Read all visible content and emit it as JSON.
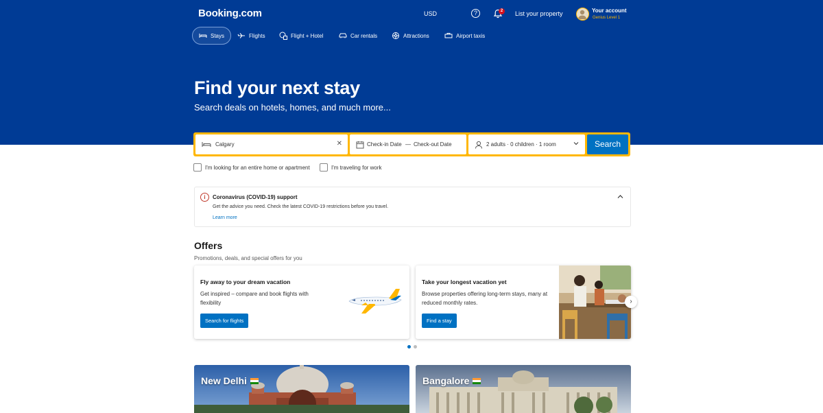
{
  "header": {
    "logo": "Booking.com",
    "currency": "USD",
    "help_glyph": "?",
    "notification_count": "2",
    "list_property": "List your property",
    "account_name": "Your account",
    "account_level": "Genius Level 1"
  },
  "nav": {
    "items": [
      {
        "label": "Stays",
        "icon": "bed-icon",
        "active": true
      },
      {
        "label": "Flights",
        "icon": "plane-icon"
      },
      {
        "label": "Flight + Hotel",
        "icon": "flight-hotel-icon"
      },
      {
        "label": "Car rentals",
        "icon": "car-icon"
      },
      {
        "label": "Attractions",
        "icon": "attractions-icon"
      },
      {
        "label": "Airport taxis",
        "icon": "taxi-icon"
      }
    ]
  },
  "hero": {
    "title": "Find your next stay",
    "subtitle": "Search deals on hotels, homes, and much more..."
  },
  "search": {
    "destination": "Calgary",
    "clear_glyph": "✕",
    "checkin_placeholder": "Check-in Date",
    "dates_separator": "—",
    "checkout_placeholder": "Check-out Date",
    "guests": "2 adults · 0 children · 1 room",
    "button": "Search",
    "checkbox_home": "I'm looking for an entire home or apartment",
    "checkbox_work": "I'm traveling for work"
  },
  "covid": {
    "icon_glyph": "i",
    "title": "Coronavirus (COVID-19) support",
    "text": "Get the advice you need. Check the latest COVID-19 restrictions before you travel.",
    "link": "Learn more"
  },
  "offers": {
    "title": "Offers",
    "subtitle": "Promotions, deals, and special offers for you",
    "cards": [
      {
        "title": "Fly away to your dream vacation",
        "text": "Get inspired – compare and book flights with flexibility",
        "button": "Search for flights"
      },
      {
        "title": "Take your longest vacation yet",
        "text": "Browse properties offering long-term stays, many at reduced monthly rates.",
        "button": "Find a stay"
      }
    ],
    "next_glyph": "›"
  },
  "destinations": [
    {
      "name": "New Delhi"
    },
    {
      "name": "Bangalore"
    }
  ],
  "colors": {
    "brand_blue": "#003b95",
    "accent_yellow": "#ffb700",
    "button_blue": "#0071c2"
  }
}
